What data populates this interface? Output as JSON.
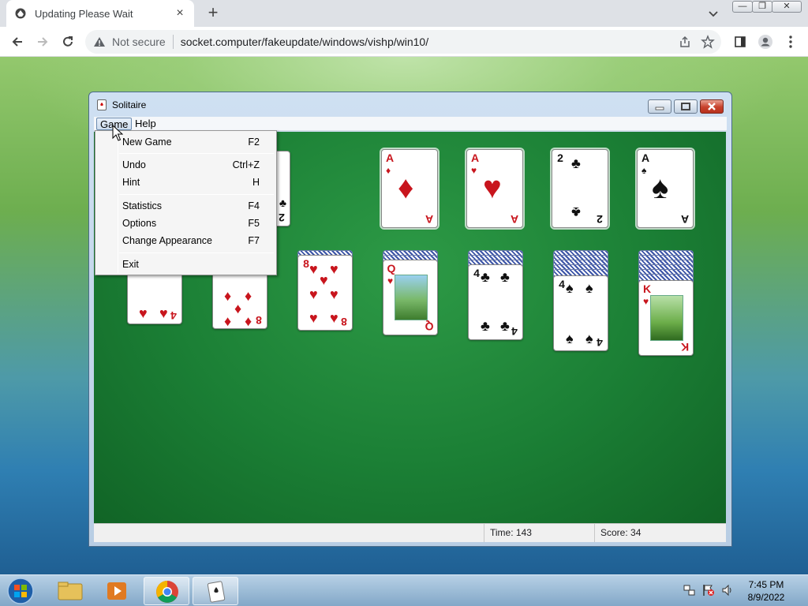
{
  "browser": {
    "tab_title": "Updating Please Wait",
    "security_label": "Not secure",
    "url": "socket.computer/fakeupdate/windows/vishp/win10/"
  },
  "window": {
    "title": "Solitaire",
    "menus": [
      "Game",
      "Help"
    ]
  },
  "game_menu": {
    "items": [
      {
        "label": "New Game",
        "shortcut": "F2"
      },
      {
        "label": "Undo",
        "shortcut": "Ctrl+Z"
      },
      {
        "label": "Hint",
        "shortcut": "H"
      },
      {
        "label": "Statistics",
        "shortcut": "F4"
      },
      {
        "label": "Options",
        "shortcut": "F5"
      },
      {
        "label": "Change Appearance",
        "shortcut": "F7"
      },
      {
        "label": "Exit",
        "shortcut": ""
      }
    ]
  },
  "board": {
    "stock_partial_card": {
      "rank": "2",
      "suit": "♣"
    },
    "foundations": [
      {
        "rank": "A",
        "suit": "♦",
        "color": "red"
      },
      {
        "rank": "A",
        "suit": "♥",
        "color": "red"
      },
      {
        "rank": "2",
        "suit": "♣",
        "color": "black"
      },
      {
        "rank": "A",
        "suit": "♠",
        "color": "black"
      }
    ],
    "tableau_top": [
      {
        "rank": "4",
        "suit": "♥",
        "color": "red"
      },
      {
        "rank": "8",
        "suit": "♦",
        "color": "red"
      },
      {
        "rank": "8",
        "suit": "♥",
        "color": "red"
      },
      {
        "rank": "Q",
        "suit": "♥",
        "color": "red"
      },
      {
        "rank": "4",
        "suit": "♣",
        "color": "black"
      },
      {
        "rank": "4",
        "suit": "♠",
        "color": "black"
      },
      {
        "rank": "K",
        "suit": "♥",
        "color": "red"
      }
    ]
  },
  "status": {
    "time_label": "Time:",
    "time_value": "143",
    "score_label": "Score:",
    "score_value": "34"
  },
  "taskbar": {
    "time": "7:45 PM",
    "date": "8/9/2022"
  }
}
